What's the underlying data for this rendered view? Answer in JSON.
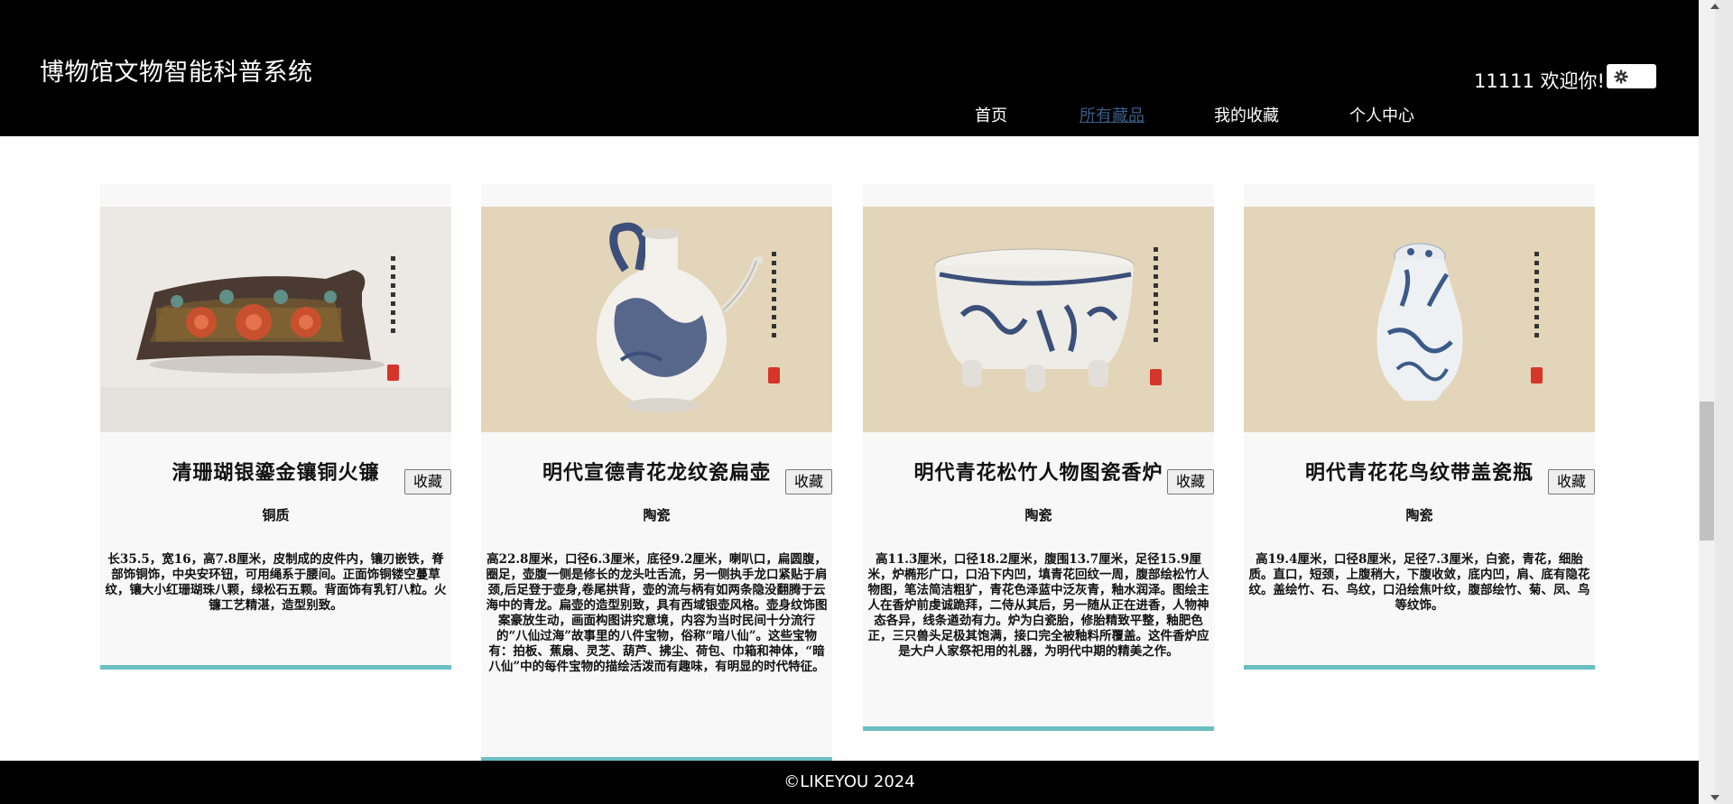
{
  "header": {
    "brand": "博物馆文物智能科普系统",
    "welcome": "11111 欢迎你!",
    "settings_icon": "gear-icon",
    "nav": [
      {
        "label": "首页",
        "active": false
      },
      {
        "label": "所有藏品",
        "active": true
      },
      {
        "label": "我的收藏",
        "active": false
      },
      {
        "label": "个人中心",
        "active": false
      }
    ]
  },
  "cards": [
    {
      "title": "清珊瑚银鎏金镶铜火镰",
      "category": "铜质",
      "favorite_label": "收藏",
      "description": "长35.5，宽16，高7.8厘米，皮制成的皮件内，镶刃嵌铁，脊部饰铜饰，中央安环钮，可用绳系于腰间。正面饰铜镂空蔓草纹，镶大小红珊瑚珠八颗，绿松石五颗。背面饰有乳钉八粒。火镰工艺精湛，造型别致。"
    },
    {
      "title": "明代宣德青花龙纹瓷扁壶",
      "category": "陶瓷",
      "favorite_label": "收藏",
      "description": "高22.8厘米，口径6.3厘米，底径9.2厘米，喇叭口，扁圆腹，圈足，壶腹一侧是修长的龙头吐舌流，另一侧执手龙口紧贴于肩颈,后足登于壶身,卷尾拱背，壶的流与柄有如两条隐没翻腾于云海中的青龙。扁壶的造型别致，具有西域银壶风格。壶身纹饰图案豪放生动，画面构图讲究意境，内容为当时民间十分流行的“八仙过海”故事里的八件宝物，俗称“暗八仙”。这些宝物有：拍板、蕉扇、灵芝、葫芦、拂尘、荷包、巾箱和神体，“暗八仙”中的每件宝物的描绘活泼而有趣味，有明显的时代特征。"
    },
    {
      "title": "明代青花松竹人物图瓷香炉",
      "category": "陶瓷",
      "favorite_label": "收藏",
      "description": "高11.3厘米，口径18.2厘米，腹围13.7厘米，足径15.9厘米，炉椭形广口，口沿下内凹，填青花回纹一周，腹部绘松竹人物图，笔法简洁粗犷，青花色泽蓝中泛灰青，釉水润泽。图绘主人在香炉前虔诚跪拜，二侍从其后，另一随从正在进香，人物神态各异，线条遒劲有力。炉为白瓷胎，修胎精致平整，釉肥色正，三只兽头足极其饱满，接口完全被釉料所覆盖。这件香炉应是大户人家祭祀用的礼器，为明代中期的精美之作。"
    },
    {
      "title": "明代青花花鸟纹带盖瓷瓶",
      "category": "陶瓷",
      "favorite_label": "收藏",
      "description": "高19.4厘米，口径8厘米，足径7.3厘米，白瓷，青花，细胎质。直口，短颈，上腹稍大，下腹收敛，底内凹，肩、底有隐花纹。盖绘竹、石、鸟纹，口沿绘焦叶纹，腹部绘竹、菊、凤、鸟等纹饰。"
    }
  ],
  "footer": {
    "copyright": "©LIKEYOU 2024"
  },
  "colors": {
    "header_bg": "#000000",
    "nav_active": "#3a5d86",
    "card_accent": "#6bbfc3",
    "card_bg": "#f8f8f8"
  }
}
